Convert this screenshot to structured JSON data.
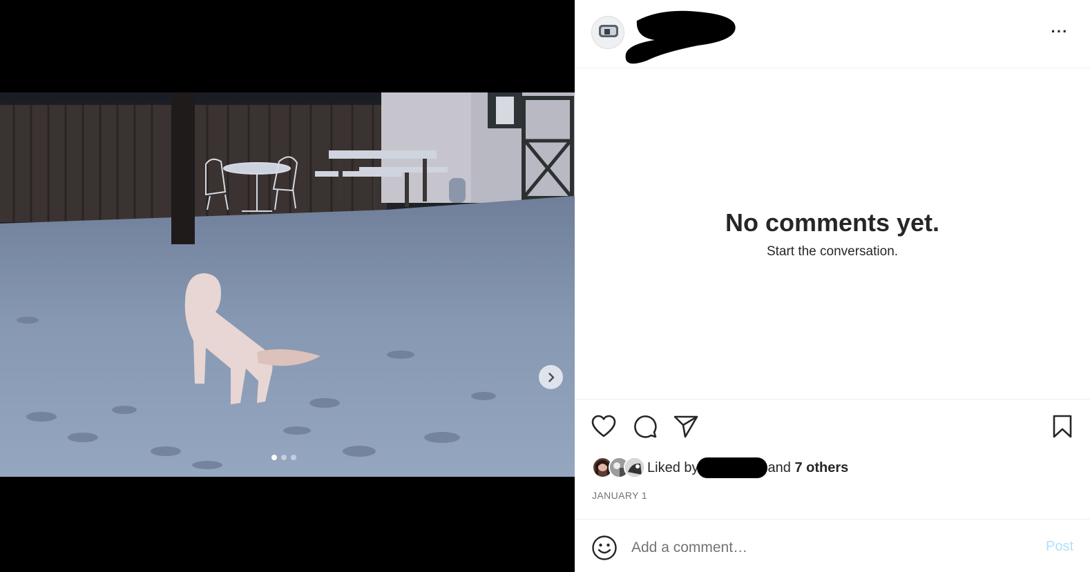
{
  "post": {
    "more_label": "···",
    "media": {
      "slide_count": 3,
      "active_slide": 1,
      "next_icon": "chevron-right-icon"
    }
  },
  "comments": {
    "empty_title": "No comments yet.",
    "empty_subtitle": "Start the conversation."
  },
  "likes": {
    "prefix": "Liked by",
    "conjunction": "and",
    "others": "7 others"
  },
  "date": "JANUARY 1",
  "comment_box": {
    "placeholder": "Add a comment…",
    "post_label": "Post"
  },
  "colors": {
    "post_disabled": "#b2dffc",
    "secondary_text": "#737373",
    "divider": "#efefef"
  }
}
